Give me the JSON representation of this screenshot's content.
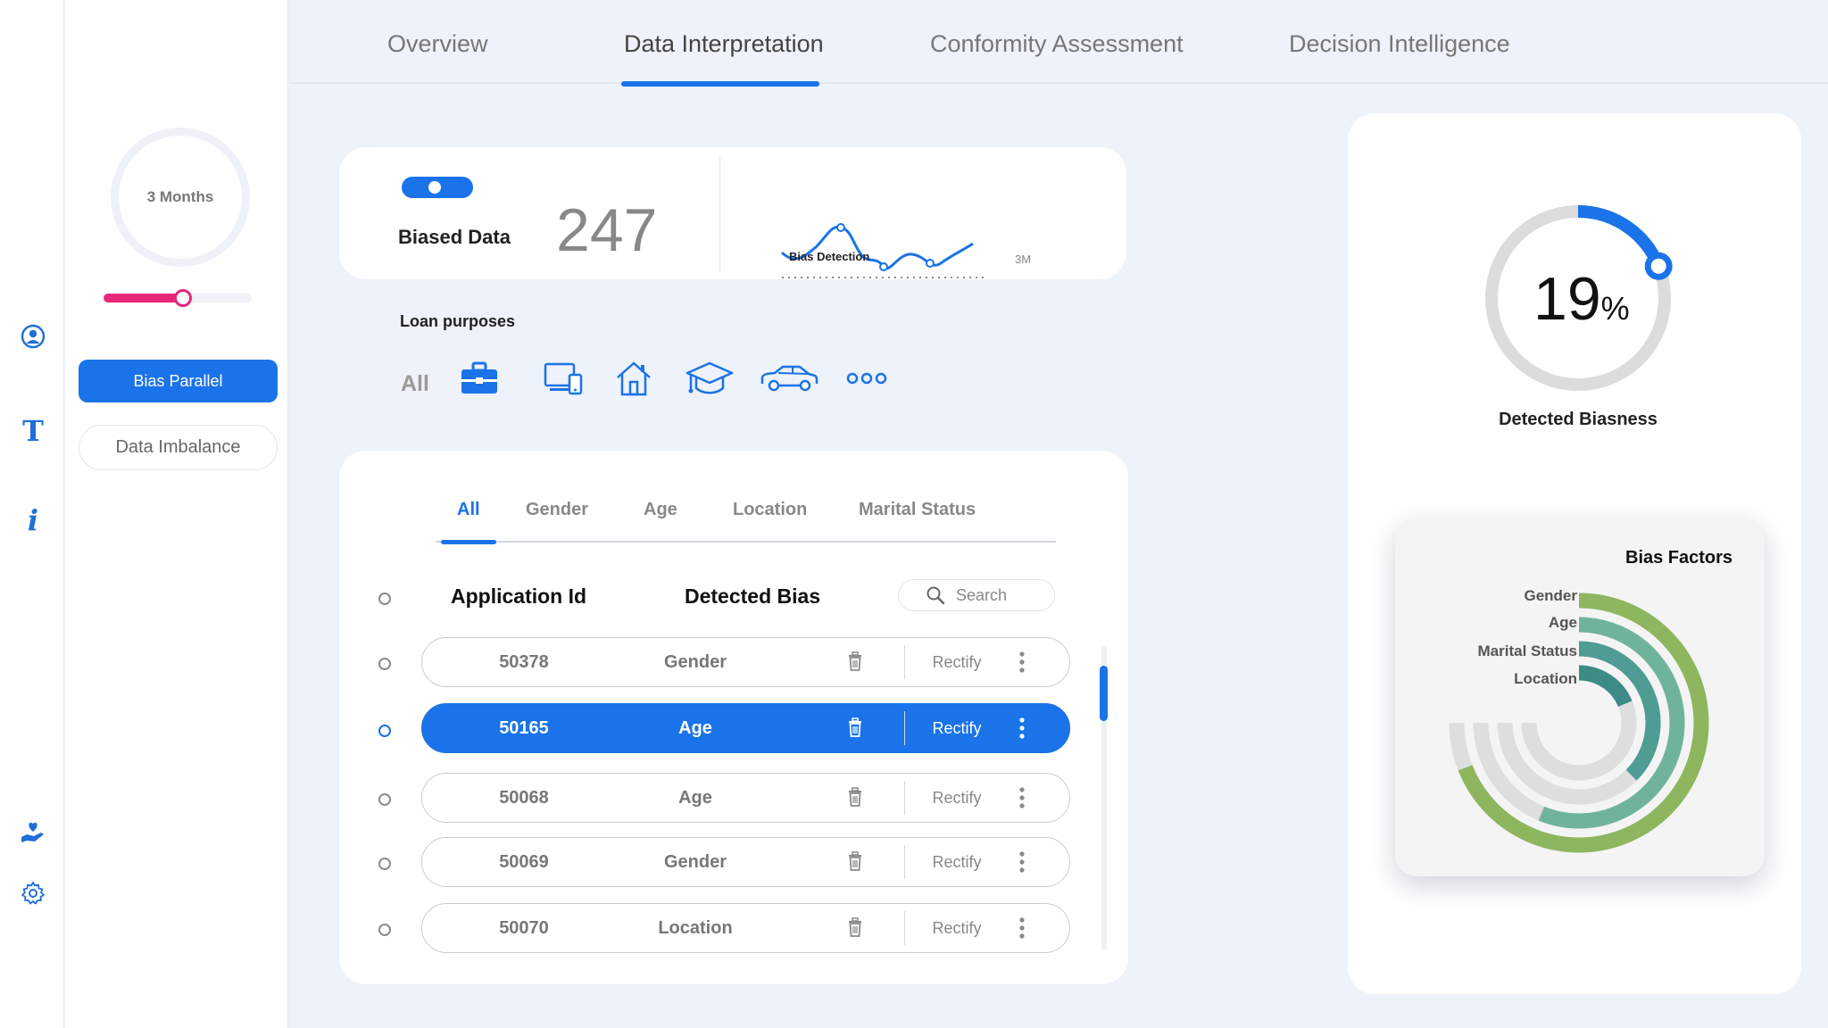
{
  "nav": {
    "rail_icons": [
      "user-circle-icon",
      "text-icon",
      "info-icon",
      "care-hand-icon",
      "gear-icon"
    ],
    "text_glyph": "T",
    "info_glyph": "i"
  },
  "filters": {
    "period_label": "3 Months",
    "slider_value": 0.55,
    "primary_button": "Bias Parallel",
    "secondary_button": "Data Imbalance",
    "accent_color": "#e8267a"
  },
  "top_tabs": [
    {
      "label": "Overview"
    },
    {
      "label": "Data Interpretation"
    },
    {
      "label": "Conformity Assessment"
    },
    {
      "label": "Decision Intelligence"
    }
  ],
  "summary": {
    "label": "Biased Data",
    "count": "247",
    "chart_caption": "Bias Detection",
    "chart_period": "3M"
  },
  "loan": {
    "title": "Loan purposes",
    "all_label": "All",
    "icons": [
      "briefcase-icon",
      "devices-icon",
      "home-icon",
      "graduation-cap-icon",
      "car-icon",
      "more-icon"
    ]
  },
  "table": {
    "filter_tabs": [
      "All",
      "Gender",
      "Age",
      "Location",
      "Marital Status"
    ],
    "col_id": "Application Id",
    "col_bias": "Detected Bias",
    "search_placeholder": "Search",
    "rows": [
      {
        "id": "50378",
        "bias": "Gender",
        "action": "Rectify"
      },
      {
        "id": "50165",
        "bias": "Age",
        "action": "Rectify"
      },
      {
        "id": "50068",
        "bias": "Age",
        "action": "Rectify"
      },
      {
        "id": "50069",
        "bias": "Gender",
        "action": "Rectify"
      },
      {
        "id": "50070",
        "bias": "Location",
        "action": "Rectify"
      }
    ]
  },
  "biasness": {
    "value": "19",
    "unit": "%",
    "fraction": 0.19,
    "label": "Detected Biasness",
    "color": "#1a73e8"
  },
  "factors": {
    "title": "Bias Factors",
    "items": [
      {
        "label": "Gender",
        "fraction": 0.92,
        "color": "#8db65e"
      },
      {
        "label": "Age",
        "fraction": 0.75,
        "color": "#6fb49a"
      },
      {
        "label": "Marital Status",
        "fraction": 0.5,
        "color": "#4e9c93"
      },
      {
        "label": "Location",
        "fraction": 0.25,
        "color": "#3c8b87"
      }
    ]
  }
}
